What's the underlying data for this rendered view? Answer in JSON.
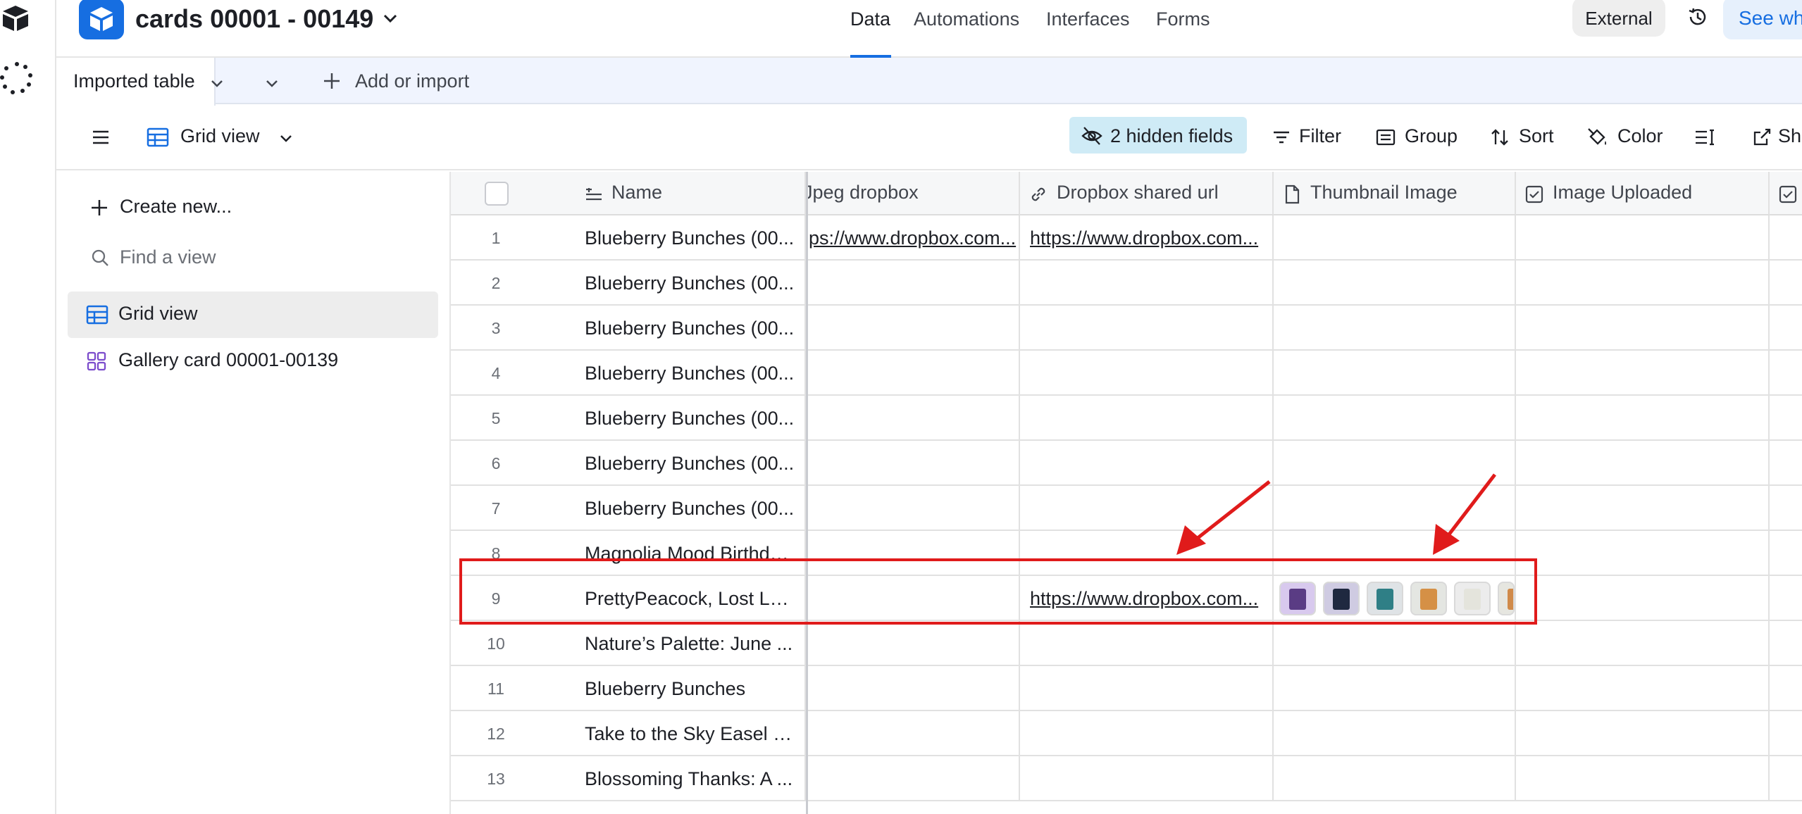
{
  "header": {
    "base_title": "cards 00001 - 00149",
    "tabs": [
      "Data",
      "Automations",
      "Interfaces",
      "Forms"
    ],
    "active_tab": "Data",
    "external_label": "External",
    "see_label": "See wh"
  },
  "tablebar": {
    "table_name": "Imported table",
    "add_label": "Add or import"
  },
  "toolbar": {
    "view_name": "Grid view",
    "hidden_fields": "2 hidden fields",
    "filter": "Filter",
    "group": "Group",
    "sort": "Sort",
    "color": "Color",
    "share": "Sh"
  },
  "sidebar": {
    "create_label": "Create new...",
    "find_placeholder": "Find a view",
    "views": [
      {
        "label": "Grid view",
        "icon": "grid-icon",
        "active": true
      },
      {
        "label": "Gallery card 00001-00139",
        "icon": "gallery-icon",
        "active": false
      }
    ]
  },
  "grid": {
    "columns": [
      "Name",
      "Jpeg dropbox",
      "Dropbox shared url",
      "Thumbnail Image",
      "Image Uploaded"
    ],
    "col_jpeg_visible": "Jpeg dropbox",
    "rows": [
      {
        "num": "1",
        "name": "Blueberry Bunches (00...",
        "jpeg": "ps://www.dropbox.com...",
        "url": "https://www.dropbox.com..."
      },
      {
        "num": "2",
        "name": "Blueberry Bunches (00...",
        "jpeg": "",
        "url": ""
      },
      {
        "num": "3",
        "name": "Blueberry Bunches (00...",
        "jpeg": "",
        "url": ""
      },
      {
        "num": "4",
        "name": "Blueberry Bunches (00...",
        "jpeg": "",
        "url": ""
      },
      {
        "num": "5",
        "name": "Blueberry Bunches (00...",
        "jpeg": "",
        "url": ""
      },
      {
        "num": "6",
        "name": "Blueberry Bunches (00...",
        "jpeg": "",
        "url": ""
      },
      {
        "num": "7",
        "name": "Blueberry Bunches (00...",
        "jpeg": "",
        "url": ""
      },
      {
        "num": "8",
        "name": "Magnolia Mood Birthda...",
        "jpeg": "",
        "url": ""
      },
      {
        "num": "9",
        "name": "PrettyPeacock, Lost La...",
        "jpeg": "",
        "url": "https://www.dropbox.com..."
      },
      {
        "num": "10",
        "name": "Nature’s Palette: June ...",
        "jpeg": "",
        "url": ""
      },
      {
        "num": "11",
        "name": "Blueberry Bunches",
        "jpeg": "",
        "url": ""
      },
      {
        "num": "12",
        "name": "Take to the Sky Easel C...",
        "jpeg": "",
        "url": ""
      },
      {
        "num": "13",
        "name": "Blossoming Thanks: A ...",
        "jpeg": "",
        "url": ""
      }
    ]
  },
  "colors": {
    "accent": "#166ee1",
    "hidden_fields_bg": "#cfebf6",
    "annotation_red": "#e01b1b"
  }
}
